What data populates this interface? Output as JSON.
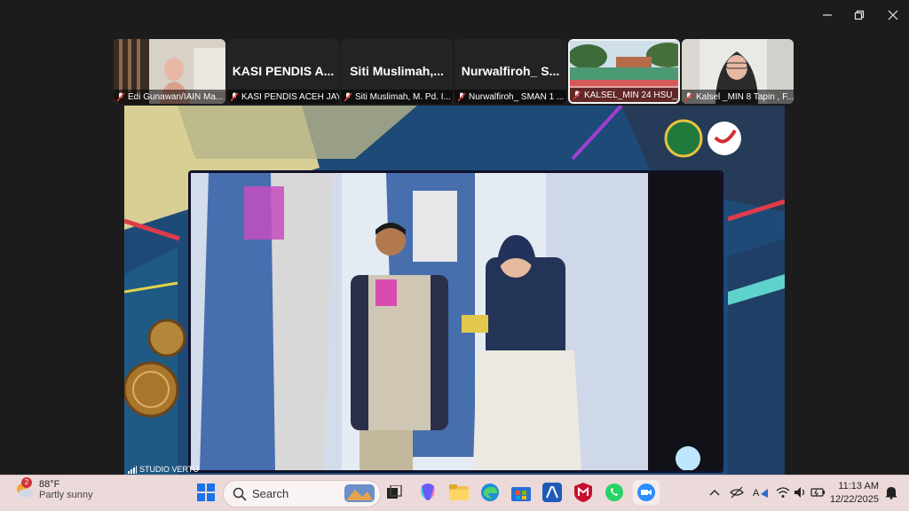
{
  "participants": [
    {
      "kind": "video",
      "label": "Edi Gunawan/IAIN Ma..."
    },
    {
      "kind": "name",
      "big_name": "KASI PENDIS A...",
      "label": "KASI PENDIS ACEH JAYA"
    },
    {
      "kind": "name",
      "big_name": "Siti Muslimah,...",
      "label": "Siti Muslimah, M. Pd. I..."
    },
    {
      "kind": "name",
      "big_name": "Nurwalfiroh_ S...",
      "label": "Nurwalfiroh_ SMAN 1 ..."
    },
    {
      "kind": "video",
      "label": "KALSEL_MIN 24 HSU_..."
    },
    {
      "kind": "video",
      "label": "Kalsel _MIN 8 Tapin , F..."
    }
  ],
  "main_video": {
    "source_label": "STUDIO VERTU"
  },
  "taskbar": {
    "weather": {
      "badge": "2",
      "temp": "88°F",
      "desc": "Partly sunny"
    },
    "search_placeholder": "Search",
    "clock": {
      "time": "11:13 AM",
      "date": "12/22/2025"
    }
  },
  "colors": {
    "taskbar_bg": "#ecd9d9",
    "titlebar_bg": "#1c1c1c"
  }
}
